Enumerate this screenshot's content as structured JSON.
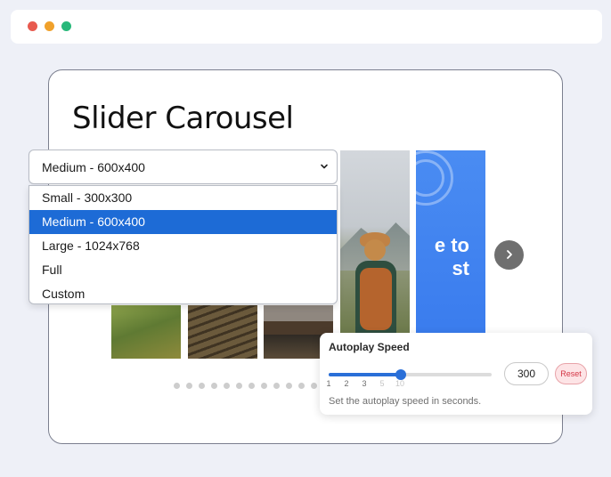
{
  "window": {
    "controls": [
      {
        "name": "close",
        "color": "#e85a4f"
      },
      {
        "name": "minimize",
        "color": "#f0a12b"
      },
      {
        "name": "maximize",
        "color": "#28b87a"
      }
    ]
  },
  "page": {
    "title": "Slider Carousel"
  },
  "size_select": {
    "value": "Medium - 600x400",
    "options": [
      {
        "label": "Small - 300x300",
        "selected": false
      },
      {
        "label": "Medium - 600x400",
        "selected": true
      },
      {
        "label": "Large - 1024x768",
        "selected": false
      },
      {
        "label": "Full",
        "selected": false
      },
      {
        "label": "Custom",
        "selected": false
      }
    ]
  },
  "carousel": {
    "slide_text": "e to\nst",
    "next_icon": "chevron-right-icon",
    "pagination_count": 12,
    "active_page": 0
  },
  "autoplay": {
    "title": "Autoplay Speed",
    "ticks": [
      {
        "label": "1",
        "muted": false
      },
      {
        "label": "2",
        "muted": false
      },
      {
        "label": "3",
        "muted": false
      },
      {
        "label": "5",
        "muted": true
      },
      {
        "label": "10",
        "muted": true
      }
    ],
    "slider_value": 3,
    "input_value": "300",
    "reset_label": "Reset",
    "hint": "Set the autoplay speed in seconds."
  },
  "colors": {
    "accent": "#1d6bd6",
    "slider": "#2a6fd8",
    "reset_bg": "#fde4e6",
    "reset_text": "#d43545",
    "background": "#eef0f7"
  }
}
